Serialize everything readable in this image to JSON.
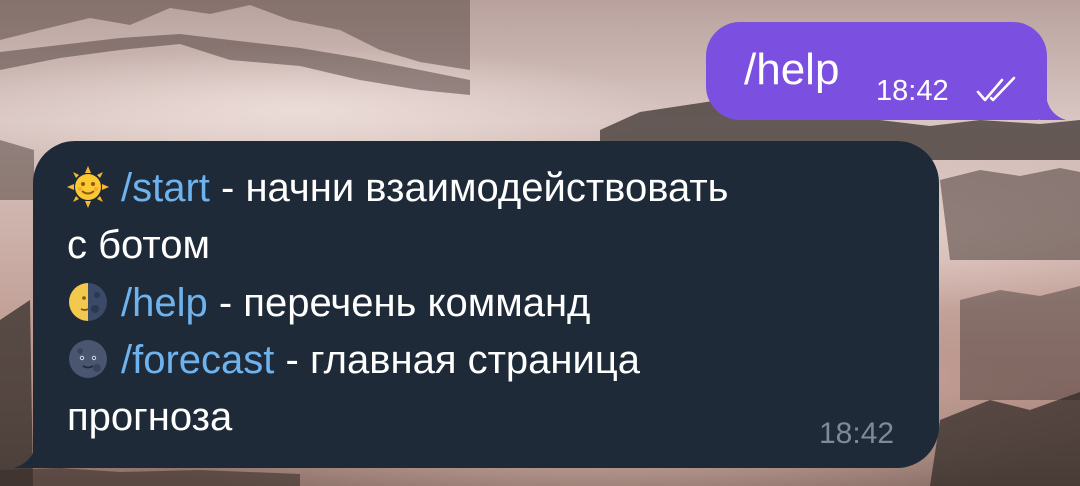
{
  "chat": {
    "outgoing": {
      "text": "/help",
      "time": "18:42",
      "status_icon": "double-check-icon",
      "bubble_color": "#7b4fe0"
    },
    "incoming": {
      "lines": [
        {
          "emoji": "sun-face-emoji",
          "command": "/start",
          "text": " - начни взаимодействовать"
        },
        {
          "text": "с ботом"
        },
        {
          "emoji": "first-quarter-moon-face-emoji",
          "command": "/help",
          "text": " - перечень комманд"
        },
        {
          "emoji": "new-moon-face-emoji",
          "command": "/forecast",
          "text": " - главная страница"
        },
        {
          "text": "прогноза"
        }
      ],
      "time": "18:42",
      "bubble_color": "#1f2a38",
      "command_color": "#6fb3ee"
    }
  }
}
